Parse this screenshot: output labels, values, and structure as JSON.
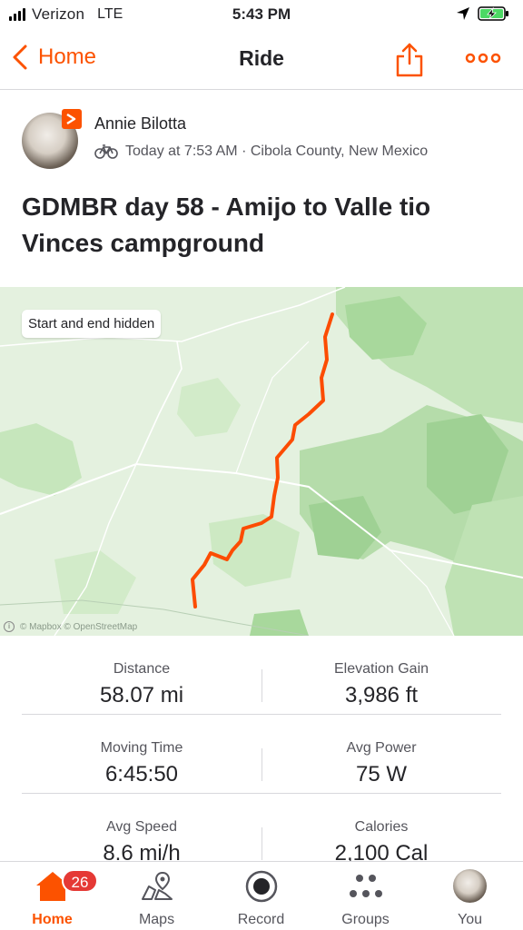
{
  "status_bar": {
    "carrier": "Verizon",
    "network": "LTE",
    "time": "5:43 PM",
    "icons": [
      "signal-icon",
      "location-arrow-icon",
      "battery-charging-icon"
    ]
  },
  "nav": {
    "back_label": "Home",
    "title": "Ride",
    "share_icon": "share-icon",
    "more_icon": "more-icon"
  },
  "athlete": {
    "name": "Annie Bilotta",
    "meta": "Today at 7:53 AM · Cibola County, New Mexico",
    "activity_icon": "bike-icon"
  },
  "activity": {
    "title": "GDMBR day 58 - Amijo to Valle tio Vinces campground"
  },
  "map": {
    "privacy_label": "Start and end hidden",
    "attribution": "© Mapbox © OpenStreetMap",
    "route_color": "#fc4c02"
  },
  "stats": [
    {
      "left": {
        "label": "Distance",
        "value": "58.07 mi"
      },
      "right": {
        "label": "Elevation Gain",
        "value": "3,986 ft"
      }
    },
    {
      "left": {
        "label": "Moving Time",
        "value": "6:45:50"
      },
      "right": {
        "label": "Avg Power",
        "value": "75 W"
      }
    },
    {
      "left": {
        "label": "Avg Speed",
        "value": "8.6 mi/h"
      },
      "right": {
        "label": "Calories",
        "value": "2,100 Cal"
      }
    }
  ],
  "tabs": [
    {
      "label": "Home",
      "icon": "home-icon",
      "badge": "26",
      "active": true
    },
    {
      "label": "Maps",
      "icon": "maps-icon"
    },
    {
      "label": "Record",
      "icon": "record-icon"
    },
    {
      "label": "Groups",
      "icon": "groups-icon"
    },
    {
      "label": "You",
      "icon": "avatar"
    }
  ],
  "colors": {
    "accent": "#fc5200",
    "badge": "#e53935"
  }
}
